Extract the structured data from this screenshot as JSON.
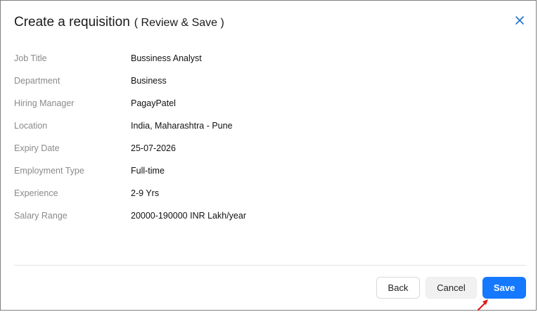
{
  "dialog": {
    "title": "Create a requisition",
    "subtitle": "( Review & Save )"
  },
  "fields": [
    {
      "label": "Job Title",
      "value": "Bussiness Analyst"
    },
    {
      "label": "Department",
      "value": "Business"
    },
    {
      "label": "Hiring Manager",
      "value": "PagayPatel"
    },
    {
      "label": "Location",
      "value": "India, Maharashtra - Pune"
    },
    {
      "label": "Expiry Date",
      "value": "25-07-2026"
    },
    {
      "label": "Employment Type",
      "value": "Full-time"
    },
    {
      "label": "Experience",
      "value": "2-9 Yrs"
    },
    {
      "label": "Salary Range",
      "value": "20000-190000 INR Lakh/year"
    }
  ],
  "footer": {
    "back_label": "Back",
    "cancel_label": "Cancel",
    "save_label": "Save"
  },
  "icons": {
    "close": "close-icon",
    "cursor": "red-arrow-cursor-icon"
  },
  "colors": {
    "accent": "#1479ff",
    "close_icon": "#1a73c8",
    "cursor_arrow": "#e01b1b"
  }
}
